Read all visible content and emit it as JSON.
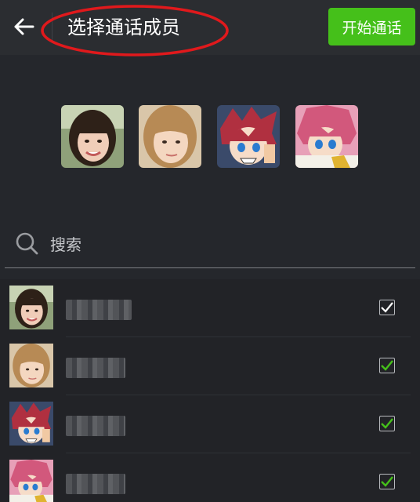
{
  "header": {
    "title": "选择通话成员",
    "start_button": "开始通话"
  },
  "selected": [
    {
      "name": "avatar-girl-1"
    },
    {
      "name": "avatar-girl-2"
    },
    {
      "name": "avatar-anime-1"
    },
    {
      "name": "avatar-anime-2"
    }
  ],
  "search": {
    "placeholder": "搜索"
  },
  "contacts": [
    {
      "avatar": "girl-1",
      "checked": true,
      "check_color": "#ffffff"
    },
    {
      "avatar": "girl-2",
      "checked": true,
      "check_color": "#45c01a"
    },
    {
      "avatar": "anime-1",
      "checked": true,
      "check_color": "#45c01a"
    },
    {
      "avatar": "anime-2",
      "checked": true,
      "check_color": "#45c01a"
    }
  ],
  "colors": {
    "accent": "#45c01a",
    "annotation": "#e0191c",
    "background": "#25272c"
  }
}
